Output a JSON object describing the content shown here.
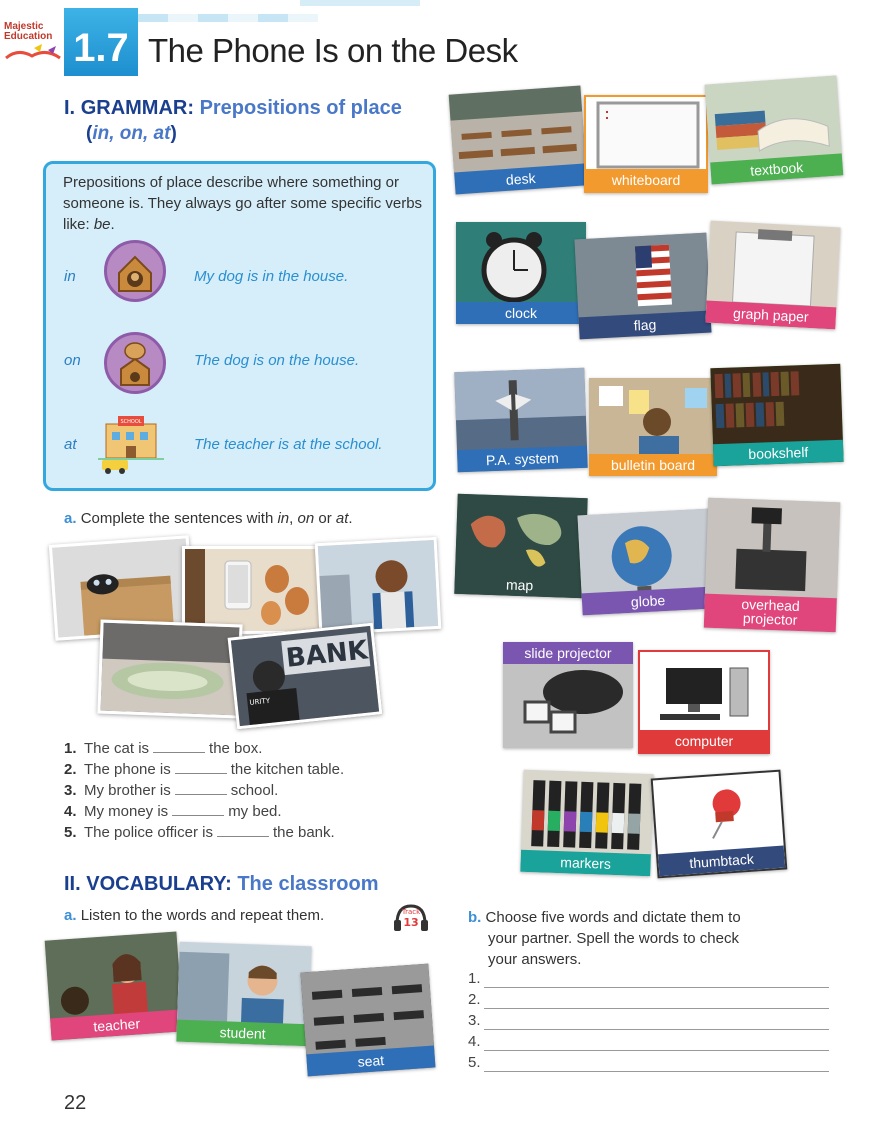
{
  "header": {
    "logo_line1": "Majestic",
    "logo_line2": "Education",
    "lesson_number": "1.7",
    "lesson_title": "The Phone Is on the Desk"
  },
  "grammar": {
    "numeral": "I.",
    "label": "GRAMMAR:",
    "topic": "Prepositions of place",
    "topic_line2_open": "(",
    "topic_words": "in, on, at",
    "topic_line2_close": ")",
    "intro_1": "Prepositions of place describe where something or someone is. They always go after some specific verbs like: ",
    "intro_be": "be",
    "intro_end": ".",
    "examples": [
      {
        "prep": "in",
        "sentence": "My dog is in the house."
      },
      {
        "prep": "on",
        "sentence": "The dog is on the house."
      },
      {
        "prep": "at",
        "sentence": "The teacher is at the school."
      }
    ],
    "school_sign": "SCHOOL"
  },
  "exercise_a": {
    "letter": "a.",
    "instruction_1": "Complete the sentences with ",
    "w_in": "in",
    "sep1": ", ",
    "w_on": "on",
    "sep2": " or ",
    "w_at": "at",
    "sep3": ".",
    "bank_sign": "BANK",
    "security_text": "URITY",
    "sentences": [
      {
        "num": "1.",
        "before": "The cat is",
        "after": "the box."
      },
      {
        "num": "2.",
        "before": "The phone is",
        "after": "the kitchen table."
      },
      {
        "num": "3.",
        "before": "My brother is",
        "after": "school."
      },
      {
        "num": "4.",
        "before": "My money is",
        "after": "my bed."
      },
      {
        "num": "5.",
        "before": "The police officer is",
        "after": "the bank."
      }
    ]
  },
  "vocabulary": {
    "numeral": "II.",
    "label": "VOCABULARY:",
    "topic": "The classroom",
    "a_letter": "a.",
    "a_text": "Listen to the words and repeat them.",
    "track_label": "Track",
    "track_number": "13",
    "b_letter": "b.",
    "b_text_lines": [
      "Choose five words and dictate them to",
      "your partner. Spell the words to check",
      "your answers."
    ],
    "answer_numbers": [
      "1.",
      "2.",
      "3.",
      "4.",
      "5."
    ],
    "cards": {
      "desk": "desk",
      "whiteboard": "whiteboard",
      "textbook": "textbook",
      "clock": "clock",
      "flag": "flag",
      "graph_paper": "graph paper",
      "pa_system": "P.A. system",
      "bulletin_board": "bulletin board",
      "bookshelf": "bookshelf",
      "map": "map",
      "globe": "globe",
      "overhead_1": "overhead",
      "overhead_2": "projector",
      "slide_projector": "slide projector",
      "computer": "computer",
      "markers": "markers",
      "thumbtack": "thumbtack",
      "teacher": "teacher",
      "student": "student",
      "seat": "seat"
    }
  },
  "page_number": "22",
  "colors": {
    "heading_dark": "#1b3f8f",
    "heading_light": "#4a78c9",
    "box_fill": "#d5eefa",
    "box_border": "#34a8de",
    "label_blue": "#2f6fb8",
    "label_orange": "#f29a2e",
    "label_green": "#4caf50",
    "label_pink": "#e0457b",
    "label_teal": "#19a39a",
    "label_purple": "#7b56b1",
    "label_red": "#e03a3a",
    "label_navy": "#334a7c"
  }
}
